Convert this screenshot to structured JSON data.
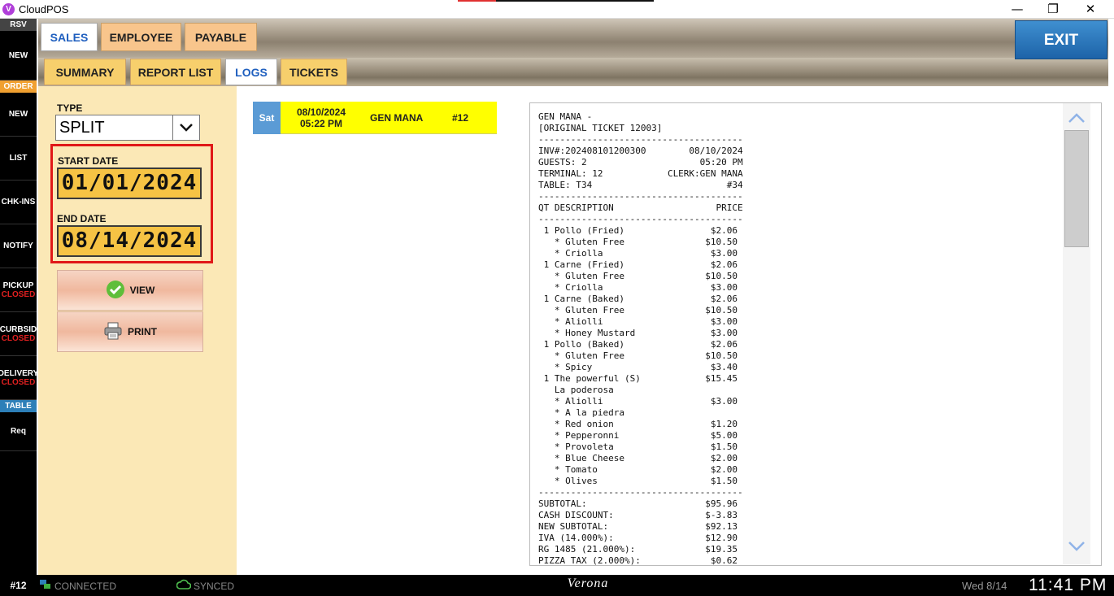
{
  "window": {
    "app_title": "CloudPOS",
    "logo_letter": "V",
    "minimize": "—",
    "restore": "❐",
    "close": "✕"
  },
  "sidebar": {
    "rsv_header": "RSV",
    "rsv_new": "NEW",
    "order_header": "ORDER",
    "order_new": "NEW",
    "list": "LIST",
    "chk_ins": "CHK-INS",
    "notify": "NOTIFY",
    "pickup": "PICKUP",
    "pickup_status": "CLOSED",
    "curbside": "CURBSID",
    "curbside_status": "CLOSED",
    "delivery": "DELIVERY",
    "delivery_status": "CLOSED",
    "table_header": "TABLE",
    "req": "Req"
  },
  "tabs": {
    "sales": "SALES",
    "employee": "EMPLOYEE",
    "payable": "PAYABLE"
  },
  "subtabs": {
    "summary": "SUMMARY",
    "report_list": "REPORT LIST",
    "logs": "LOGS",
    "tickets": "TICKETS"
  },
  "exit_label": "EXIT",
  "filters": {
    "type_label": "TYPE",
    "type_value": "SPLIT",
    "start_label": "START DATE",
    "start_value": "01/01/2024",
    "end_label": "END DATE",
    "end_value": "08/14/2024",
    "view_label": "VIEW",
    "print_label": "PRINT"
  },
  "log_entry": {
    "day": "Sat",
    "date": "08/10/2024",
    "time": "05:22 PM",
    "employee": "GEN MANA",
    "number": "#12"
  },
  "receipt": {
    "lines": [
      "GEN MANA -",
      "[ORIGINAL TICKET 12003]",
      "--------------------------------------",
      "INV#:202408101200300        08/10/2024",
      "GUESTS: 2                     05:20 PM",
      "TERMINAL: 12            CLERK:GEN MANA",
      "TABLE: T34                         #34",
      "--------------------------------------",
      "QT DESCRIPTION                   PRICE",
      "--------------------------------------",
      " 1 Pollo (Fried)                $2.06",
      "   * Gluten Free               $10.50",
      "   * Criolla                    $3.00",
      " 1 Carne (Fried)                $2.06",
      "   * Gluten Free               $10.50",
      "   * Criolla                    $3.00",
      " 1 Carne (Baked)                $2.06",
      "   * Gluten Free               $10.50",
      "   * Aliolli                    $3.00",
      "   * Honey Mustard              $3.00",
      " 1 Pollo (Baked)                $2.06",
      "   * Gluten Free               $10.50",
      "   * Spicy                      $3.40",
      " 1 The powerful (S)            $15.45",
      "   La poderosa",
      "   * Aliolli                    $3.00",
      "   * A la piedra",
      "   * Red onion                  $1.20",
      "   * Pepperonni                 $5.00",
      "   * Provoleta                  $1.50",
      "   * Blue Cheese                $2.00",
      "   * Tomato                     $2.00",
      "   * Olives                     $1.50",
      "--------------------------------------",
      "SUBTOTAL:                      $95.96",
      "CASH DISCOUNT:                 $-3.83",
      "NEW SUBTOTAL:                  $92.13",
      "IVA (14.000%):                 $12.90",
      "RG 1485 (21.000%):             $19.35",
      "PIZZA TAX (2.000%):             $0.62"
    ]
  },
  "statusbar": {
    "terminal": "#12",
    "connected": "CONNECTED",
    "synced": "SYNCED",
    "store": "Verona",
    "date": "Wed 8/14",
    "time": "11:41 PM"
  },
  "colors": {
    "accent_blue": "#1f5fbf",
    "tab_orange": "#f8c58c",
    "subtab_yellow": "#f7cf6c",
    "date_gold": "#f6c344",
    "closed_red": "#e02020",
    "log_yellow": "#ffff00",
    "highlight_red": "#e01818"
  },
  "icons": {
    "view": "check-circle-icon",
    "print": "printer-icon",
    "dropdown": "chevron-down-icon",
    "scroll_up": "chevron-up-icon",
    "scroll_down": "chevron-down-icon",
    "connected": "network-icon",
    "synced": "cloud-icon"
  }
}
